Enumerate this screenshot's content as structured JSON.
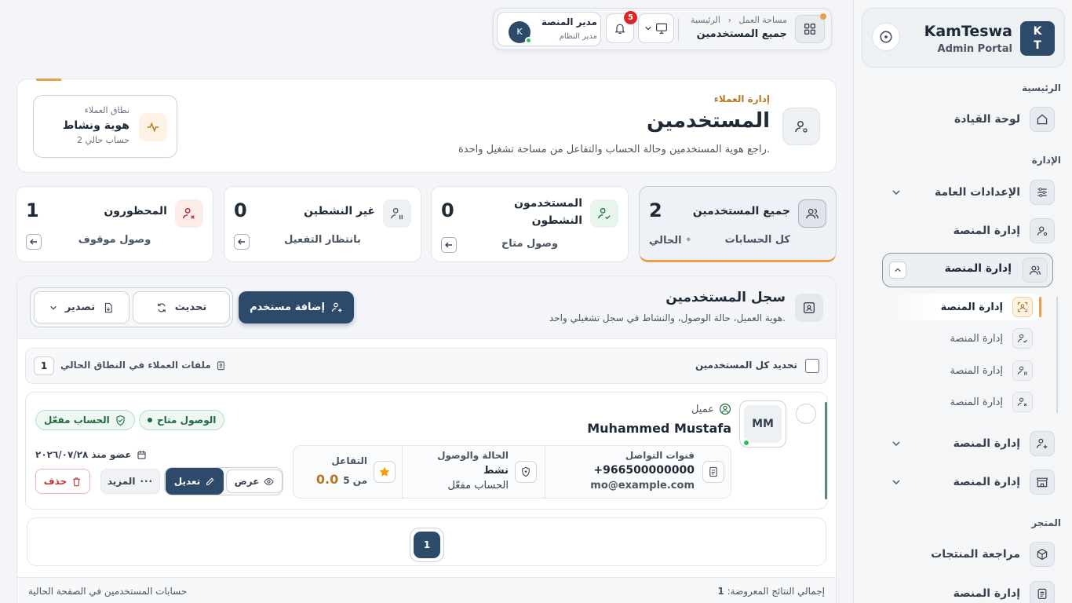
{
  "colors": {
    "primary": "#2e4a6b",
    "accent": "#e8a14a",
    "success": "#22c55e",
    "danger": "#dc2626"
  },
  "sidebar": {
    "brand_initials_top": "K",
    "brand_initials_bottom": "T",
    "brand_name": "KamTeswa",
    "brand_sub": "Admin Portal",
    "sections": {
      "home": "الرئيسية",
      "admin": "الإدارة",
      "store": "المتجر"
    },
    "items": {
      "dashboard": "لوحة القيادة",
      "general_settings": "الإعدادات العامة",
      "platform_1": "إدارة المنصة",
      "platform_2": "إدارة المنصة",
      "platform_4": "إدارة المنصة",
      "platform_5": "إدارة المنصة",
      "product_review": "مراجعة المنتجات",
      "platform_6": "إدارة المنصة"
    },
    "subitems": [
      "إدارة المنصة",
      "إدارة المنصة",
      "إدارة المنصة",
      "إدارة المنصة"
    ]
  },
  "topbar": {
    "crumb_home": "الرئيسية",
    "crumb_workspace": "مساحة العمل",
    "title": "جميع المستخدمين",
    "notif_count": "5",
    "user_initial": "K",
    "user_name": "مدير المنصة",
    "user_role": "مدير النظام"
  },
  "hero": {
    "kicker": "إدارة العملاء",
    "title": "المستخدمين",
    "subtitle": "راجع هوية المستخدمين وحالة الحساب والتفاعل من مساحة تشغيل واحدة.",
    "scope_label": "نطاق العملاء",
    "scope_value": "هوية ونشاط",
    "scope_sub": "2 حساب حالي"
  },
  "stats": [
    {
      "title": "جميع المستخدمين",
      "value": "2",
      "sub": "كل الحسابات",
      "tag": "الحالي"
    },
    {
      "title": "المستخدمون النشطون",
      "value": "0",
      "sub": "وصول متاح"
    },
    {
      "title": "غير النشطين",
      "value": "0",
      "sub": "بانتظار التفعيل"
    },
    {
      "title": "المحظورون",
      "value": "1",
      "sub": "وصول موقوف"
    }
  ],
  "registry": {
    "title": "سجل المستخدمين",
    "subtitle": "هوية العميل، حالة الوصول، والنشاط في سجل تشغيلي واحد.",
    "add_label": "إضافة مستخدم",
    "refresh_label": "تحديث",
    "export_label": "تصدير",
    "select_all": "تحديد كل المستخدمين",
    "profiles_label": "ملفات العملاء في النطاق الحالي",
    "profiles_count": "1"
  },
  "user": {
    "initials": "MM",
    "role": "عميل",
    "name": "Muhammed Mustafa",
    "access_badge": "الوصول متاح",
    "account_badge": "الحساب مفعّل",
    "contact_label": "قنوات التواصل",
    "phone": "+966500000000",
    "email": "mo@example.com",
    "status_label": "الحالة والوصول",
    "status_value": "نشط",
    "account_state": "الحساب مفعّل",
    "engagement_label": "التفاعل",
    "rating": "0.0",
    "rating_of": "من 5",
    "member_since": "عضو منذ ٢٠٢٦/٠٧/٢٨",
    "view": "عرض",
    "edit": "تعديل",
    "more": "المزيد",
    "delete": "حذف"
  },
  "pager": {
    "current": "1"
  },
  "footer": {
    "total_label": "إجمالي النتائج المعروضة:",
    "total_value": "1",
    "page_note": "حسابات المستخدمين في الصفحة الحالية"
  }
}
